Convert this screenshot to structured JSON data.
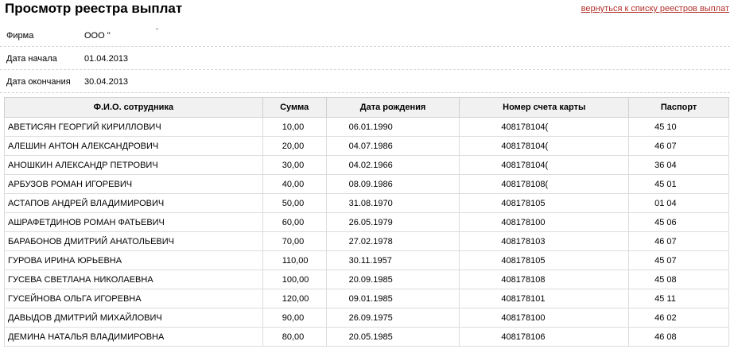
{
  "header": {
    "title": "Просмотр реестра выплат",
    "back_link": "вернуться к списку реестров выплат"
  },
  "info": {
    "firm_label": "Фирма",
    "firm_value": "ООО \"",
    "firm_extra": "\"",
    "start_label": "Дата начала",
    "start_value": "01.04.2013",
    "end_label": "Дата окончания",
    "end_value": "30.04.2013"
  },
  "table": {
    "columns": [
      "Ф.И.О. сотрудника",
      "Сумма",
      "Дата рождения",
      "Номер счета карты",
      "Паспорт"
    ],
    "rows": [
      {
        "name": "АВЕТИСЯН ГЕОРГИЙ КИРИЛЛОВИЧ",
        "sum": "10,00",
        "dob": "06.01.1990",
        "account": "408178104(",
        "passport": "45 10"
      },
      {
        "name": "АЛЕШИН АНТОН АЛЕКСАНДРОВИЧ",
        "sum": "20,00",
        "dob": "04.07.1986",
        "account": "408178104(",
        "passport": "46 07"
      },
      {
        "name": "АНОШКИН АЛЕКСАНДР ПЕТРОВИЧ",
        "sum": "30,00",
        "dob": "04.02.1966",
        "account": "408178104(",
        "passport": "36 04"
      },
      {
        "name": "АРБУЗОВ РОМАН ИГОРЕВИЧ",
        "sum": "40,00",
        "dob": "08.09.1986",
        "account": "408178108(",
        "passport": "45 01"
      },
      {
        "name": "АСТАПОВ АНДРЕЙ ВЛАДИМИРОВИЧ",
        "sum": "50,00",
        "dob": "31.08.1970",
        "account": "408178105",
        "passport": "01 04"
      },
      {
        "name": "АШРАФЕТДИНОВ РОМАН ФАТЬЕВИЧ",
        "sum": "60,00",
        "dob": "26.05.1979",
        "account": "408178100",
        "passport": "45 06"
      },
      {
        "name": "БАРАБОНОВ ДМИТРИЙ АНАТОЛЬЕВИЧ",
        "sum": "70,00",
        "dob": "27.02.1978",
        "account": "408178103",
        "passport": "46 07"
      },
      {
        "name": "ГУРОВА ИРИНА ЮРЬЕВНА",
        "sum": "110,00",
        "dob": "30.11.1957",
        "account": "408178105",
        "passport": "45 07"
      },
      {
        "name": "ГУСЕВА СВЕТЛАНА НИКОЛАЕВНА",
        "sum": "100,00",
        "dob": "20.09.1985",
        "account": "408178108",
        "passport": "45 08"
      },
      {
        "name": "ГУСЕЙНОВА ОЛЬГА ИГОРЕВНА",
        "sum": "120,00",
        "dob": "09.01.1985",
        "account": "408178101",
        "passport": "45 11"
      },
      {
        "name": "ДАВЫДОВ ДМИТРИЙ МИХАЙЛОВИЧ",
        "sum": "90,00",
        "dob": "26.09.1975",
        "account": "408178100",
        "passport": "46 02"
      },
      {
        "name": "ДЕМИНА НАТАЛЬЯ ВЛАДИМИРОВНА",
        "sum": "80,00",
        "dob": "20.05.1985",
        "account": "408178106",
        "passport": "46 08"
      }
    ]
  }
}
